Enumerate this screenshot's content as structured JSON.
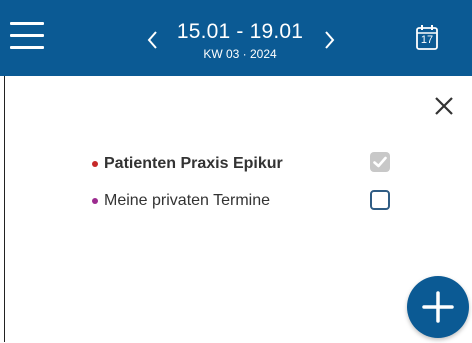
{
  "header": {
    "date_range": "15.01 - 19.01",
    "week_label": "KW 03 · 2024",
    "calendar_day": "17"
  },
  "calendars": [
    {
      "label": "Patienten Praxis Epikur",
      "dot_color": "#c62828",
      "bold": true,
      "checked": true
    },
    {
      "label": "Meine privaten Termine",
      "dot_color": "#9c2b8f",
      "bold": false,
      "checked": false
    }
  ],
  "colors": {
    "accent": "#0b5a94"
  },
  "icons": {
    "menu": "hamburger-menu-icon",
    "prev": "chevron-left-icon",
    "next": "chevron-right-icon",
    "calendar": "calendar-icon",
    "close": "close-icon",
    "check": "checkmark-icon",
    "add": "plus-icon"
  }
}
